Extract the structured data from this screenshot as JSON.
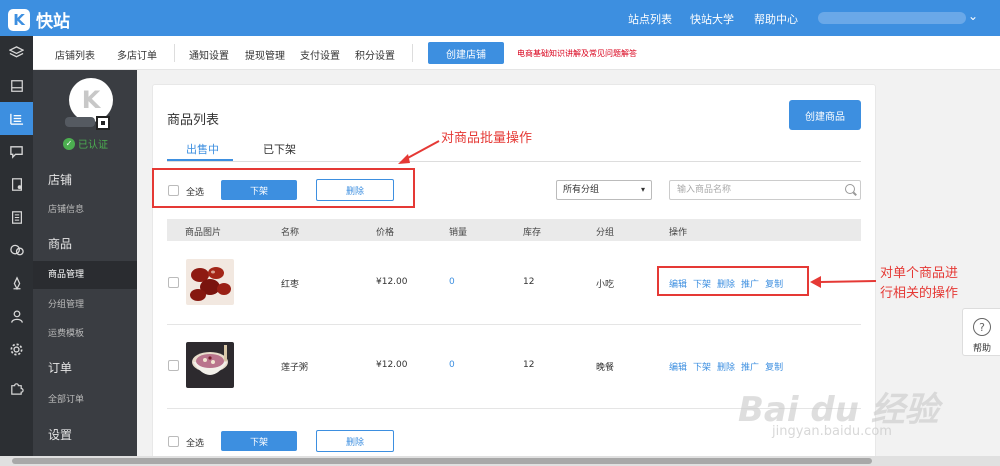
{
  "topbar": {
    "logo_mark": "K",
    "app_name": "快站",
    "nav": [
      "站点列表",
      "快站大学",
      "帮助中心"
    ],
    "user_chevron": "⌄"
  },
  "subbar": {
    "items": [
      "店铺列表",
      "多店订单",
      "通知设置",
      "提现管理",
      "支付设置",
      "积分设置"
    ],
    "create_store": "创建店铺",
    "notice": "电商基础知识讲解及常见问题解答"
  },
  "sidebar": {
    "avatar_letter": "K",
    "verified": "已认证",
    "sections": [
      {
        "title": "店铺",
        "items": [
          "店铺信息"
        ]
      },
      {
        "title": "商品",
        "items": [
          "商品管理",
          "分组管理",
          "运费模板"
        ]
      },
      {
        "title": "订单",
        "items": [
          "全部订单"
        ]
      },
      {
        "title": "设置",
        "items": []
      }
    ]
  },
  "panel": {
    "title": "商品列表",
    "create_product": "创建商品",
    "tabs": [
      "出售中",
      "已下架"
    ],
    "select_all": "全选",
    "off_shelf": "下架",
    "delete": "删除",
    "group_select": "所有分组",
    "search_placeholder": "输入商品名称",
    "columns": [
      "商品图片",
      "名称",
      "价格",
      "销量",
      "库存",
      "分组",
      "操作"
    ],
    "rows": [
      {
        "name": "红枣",
        "price": "¥12.00",
        "sales": "0",
        "stock": "12",
        "group": "小吃",
        "ops": [
          "编辑",
          "下架",
          "删除",
          "推广",
          "复制"
        ]
      },
      {
        "name": "莲子粥",
        "price": "¥12.00",
        "sales": "0",
        "stock": "12",
        "group": "晚餐",
        "ops": [
          "编辑",
          "下架",
          "删除",
          "推广",
          "复制"
        ]
      }
    ]
  },
  "annotations": {
    "batch": "对商品批量操作",
    "single_line1": "对单个商品进",
    "single_line2": "行相关的操作"
  },
  "help": {
    "icon": "?",
    "label": "帮助"
  },
  "watermark": {
    "line1": "Bai du 经验",
    "line2": "jingyan.baidu.com"
  },
  "colors": {
    "accent": "#3d8fe0",
    "annotation": "#e53935",
    "notice": "#d9001b"
  }
}
